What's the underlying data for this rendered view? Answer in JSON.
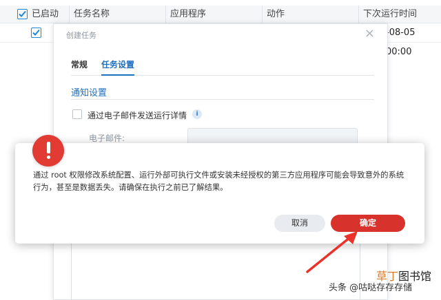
{
  "table": {
    "columns": [
      "已启动",
      "任务名称",
      "应用程序",
      "动作",
      "下次运行时间"
    ],
    "row": {
      "next_run": "-08-05 00:00"
    }
  },
  "dialog": {
    "title": "创建任务",
    "close": "×",
    "tabs": [
      {
        "label": "常规",
        "active": false
      },
      {
        "label": "任务设置",
        "active": true
      }
    ],
    "section_title": "通知设置",
    "email_option_label": "通过电子邮件发送运行详情",
    "info_icon": "i",
    "email_label": "电子邮件:"
  },
  "warning": {
    "icon": "!",
    "message": "通过 root 权限修改系统配置、运行外部可执行文件或安装未经授权的第三方应用程序可能会导致意外的系统行为，甚至是数据丢失。请确保在执行之前已了解结果。",
    "cancel_label": "取消",
    "ok_label": "确定"
  },
  "watermark": {
    "line1_a": "草丁",
    "line1_b": "图书馆",
    "line2": "头条 @咕哒存存存储"
  },
  "colors": {
    "accent_blue": "#1f6fbf",
    "danger_red": "#d8322c",
    "arrow_red": "#e8322a"
  }
}
